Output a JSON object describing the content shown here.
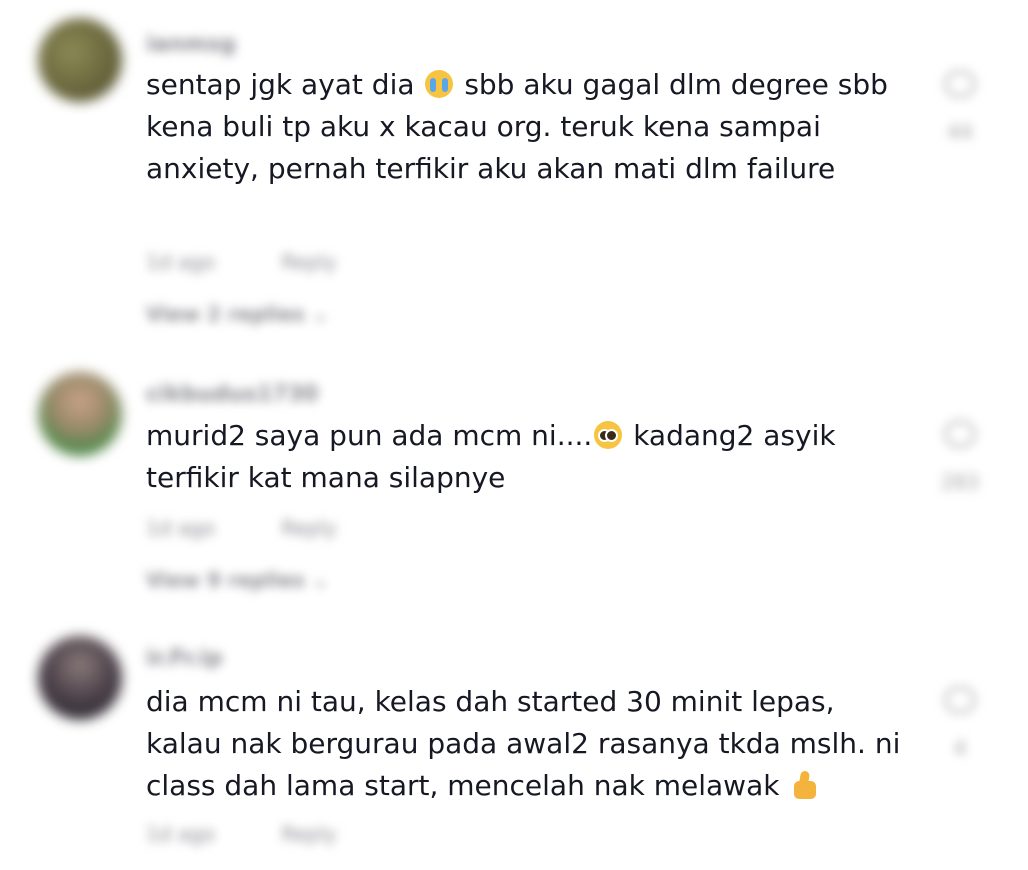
{
  "comments": [
    {
      "username": "ianmsg",
      "text_parts": [
        "sentap jgk ayat dia ",
        " sbb aku gagal dlm degree sbb kena buli tp aku x kacau org. teruk kena sampai anxiety, pernah terfikir aku akan mati dlm failure"
      ],
      "emoji": "loudly-crying-face",
      "time": "1d ago",
      "reply_label": "Reply",
      "view_replies": "View 2 replies",
      "like_count": "44",
      "avatar_color": "#6b6a3a"
    },
    {
      "username": "cikbudus1730",
      "text_parts": [
        "murid2 saya pun ada mcm ni....",
        " kadang2 asyik terfikir kat mana silapnye"
      ],
      "emoji": "pleading-face",
      "time": "1d ago",
      "reply_label": "Reply",
      "view_replies": "View 9 replies",
      "like_count": "283",
      "avatar_color": "#7c8a4e"
    },
    {
      "username": "ir.Fr.ip",
      "text_parts": [
        "dia mcm ni tau, kelas dah started 30 minit lepas, kalau nak bergurau pada awal2 rasanya tkda mslh. ni class dah lama start, mencelah nak melawak ",
        ""
      ],
      "emoji": "thumbs-up",
      "time": "1d ago",
      "reply_label": "Reply",
      "view_replies": "",
      "like_count": "4",
      "avatar_color": "#3b3540"
    }
  ]
}
